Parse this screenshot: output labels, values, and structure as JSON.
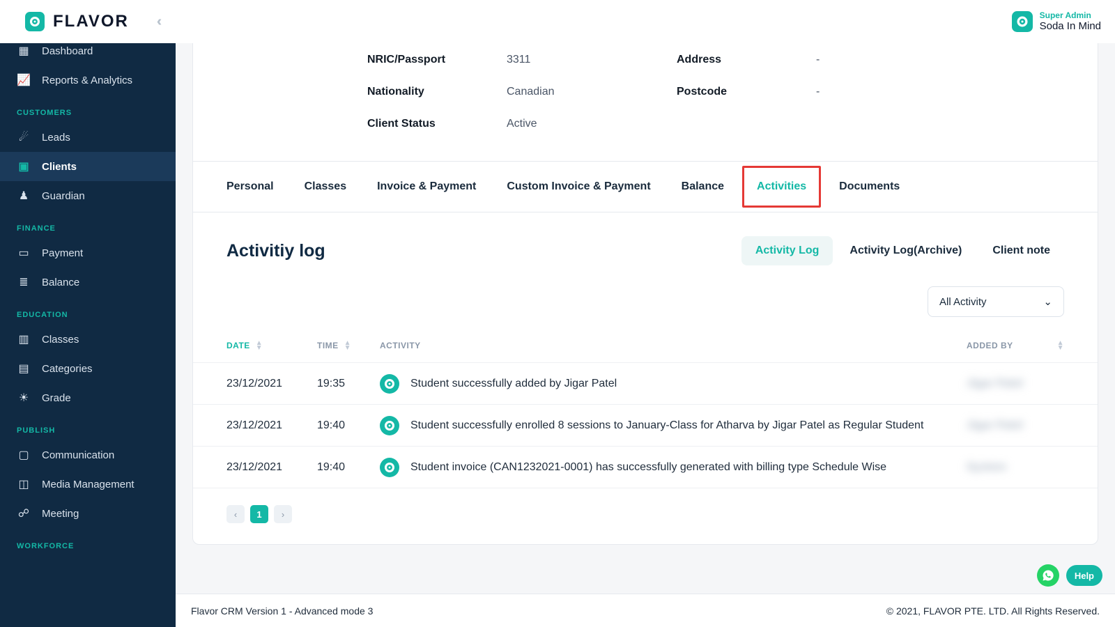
{
  "brand": {
    "name": "FLAVOR"
  },
  "user": {
    "role": "Super Admin",
    "name": "Soda In Mind"
  },
  "sidebar": {
    "top": {
      "label": "Dashboard"
    },
    "items1": [
      {
        "label": "Reports & Analytics",
        "icon": "chart"
      }
    ],
    "sectionCustomers": "CUSTOMERS",
    "customers": [
      {
        "label": "Leads",
        "icon": "signpost"
      },
      {
        "label": "Clients",
        "icon": "person-card",
        "active": true
      },
      {
        "label": "Guardian",
        "icon": "user-shield"
      }
    ],
    "sectionFinance": "FINANCE",
    "finance": [
      {
        "label": "Payment",
        "icon": "card"
      },
      {
        "label": "Balance",
        "icon": "ledger"
      }
    ],
    "sectionEducation": "EDUCATION",
    "education": [
      {
        "label": "Classes",
        "icon": "book"
      },
      {
        "label": "Categories",
        "icon": "folders"
      },
      {
        "label": "Grade",
        "icon": "people"
      }
    ],
    "sectionPublish": "PUBLISH",
    "publish": [
      {
        "label": "Communication",
        "icon": "chat"
      },
      {
        "label": "Media Management",
        "icon": "image"
      },
      {
        "label": "Meeting",
        "icon": "antenna"
      }
    ],
    "sectionWorkforce": "WORKFORCE"
  },
  "details": {
    "left": [
      {
        "label": "NRIC/Passport",
        "value": "3311"
      },
      {
        "label": "Nationality",
        "value": "Canadian"
      },
      {
        "label": "Client Status",
        "value": "Active"
      }
    ],
    "right": [
      {
        "label": "Address",
        "value": "-"
      },
      {
        "label": "Postcode",
        "value": "-"
      }
    ]
  },
  "tabs": {
    "personal": "Personal",
    "classes": "Classes",
    "invoice": "Invoice & Payment",
    "custom": "Custom Invoice & Payment",
    "balance": "Balance",
    "activities": "Activities",
    "documents": "Documents"
  },
  "section": {
    "title": "Activitiy log",
    "subtabs": {
      "log": "Activity Log",
      "archive": "Activity Log(Archive)",
      "note": "Client note"
    },
    "filter": "All Activity"
  },
  "columns": {
    "date": "DATE",
    "time": "TIME",
    "activity": "ACTIVITY",
    "added": "ADDED BY"
  },
  "rows": [
    {
      "date": "23/12/2021",
      "time": "19:35",
      "text": "Student successfully added by Jigar Patel",
      "by": "Jigar Patel"
    },
    {
      "date": "23/12/2021",
      "time": "19:40",
      "text": "Student successfully enrolled 8 sessions to January-Class for Atharva by Jigar Patel as Regular Student",
      "by": "Jigar Patel"
    },
    {
      "date": "23/12/2021",
      "time": "19:40",
      "text": "Student invoice (CAN1232021-0001) has successfully generated with billing type Schedule Wise",
      "by": "System"
    }
  ],
  "pagination": {
    "prev": "‹",
    "page": "1",
    "next": "›"
  },
  "footer": {
    "left": "Flavor CRM Version 1 - Advanced mode 3",
    "right": "© 2021, FLAVOR PTE. LTD. All Rights Reserved."
  },
  "help": {
    "label": "Help"
  }
}
